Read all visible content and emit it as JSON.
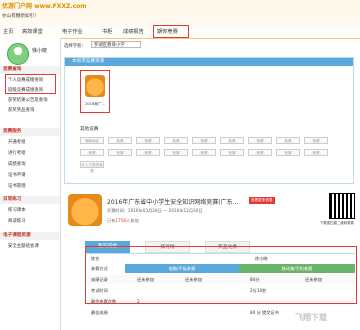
{
  "site": {
    "brand": "优游门户网 www.FXXZ.com",
    "welcome": "亦山有鞭新如引！"
  },
  "nav": {
    "items": [
      "主页",
      "高效课堂",
      "电子作业",
      "书柜",
      "成绩报告",
      "期你竞赛"
    ]
  },
  "sidebar": {
    "username": "徐小晓",
    "sections": [
      {
        "title": "竞赛查询",
        "items": [
          "个人竞赛成绩查询",
          "班级竞赛成绩查询",
          "获奖结果公告及查询",
          "获奖奖品查询"
        ]
      },
      {
        "title": "竞赛服务",
        "items": [
          "开通考组",
          "进行考组",
          "成绩查询",
          "证书申请",
          "证书管理"
        ]
      },
      {
        "title": "日常练习",
        "items": [
          "练习课本",
          "阅读练习"
        ]
      },
      {
        "title": "电子课程资源",
        "items": [
          "安全主题班会课"
        ]
      }
    ]
  },
  "filter": {
    "label": "选择学校：",
    "value": "罗湖区教育小学"
  },
  "panel": {
    "title": "本省市竞赛资源",
    "my_item_label": "2016我广...",
    "other_title": "其他竞赛",
    "chips": [
      "湖南地区",
      "竞赛",
      "竞赛",
      "竞赛",
      "竞赛",
      "竞赛",
      "竞赛",
      "竞赛",
      "竞赛",
      "竞赛",
      "竞赛",
      "竞赛",
      "竞赛",
      "竞赛",
      "竞赛",
      "竞赛",
      "竞赛",
      "竞赛",
      "未上方提供竞赛"
    ]
  },
  "contest": {
    "title": "2016年广东省中小学生安全知识网络竞赛(广东...",
    "tag": "查看更多信息",
    "dates": "开赛时间：2016年03月28日 — 2016年12月30日",
    "count_prefix": "已有",
    "count": "1758人",
    "count_suffix": "参加",
    "qr_label": "下载或扫描二维码参赛"
  },
  "tabs": [
    "我的成绩",
    "排行榜",
    "奖品兑换"
  ],
  "table": {
    "name_label": "姓名",
    "name_value": "徐小晓",
    "col_mode": "参赛方式",
    "group1": "电脑/平板参赛",
    "group2": "移动端/手机参赛",
    "rows": [
      [
        "成绩记录",
        "还未参加",
        "还未参加",
        "84分",
        "还未参加"
      ],
      [
        "考试时间",
        "",
        "",
        "2分10秒",
        ""
      ],
      [
        "剩余参赛次数",
        "2",
        "",
        "",
        ""
      ],
      [
        "最佳成绩",
        "",
        "",
        "84 分  提交证书",
        ""
      ]
    ]
  },
  "watermark": "飞翔下载"
}
